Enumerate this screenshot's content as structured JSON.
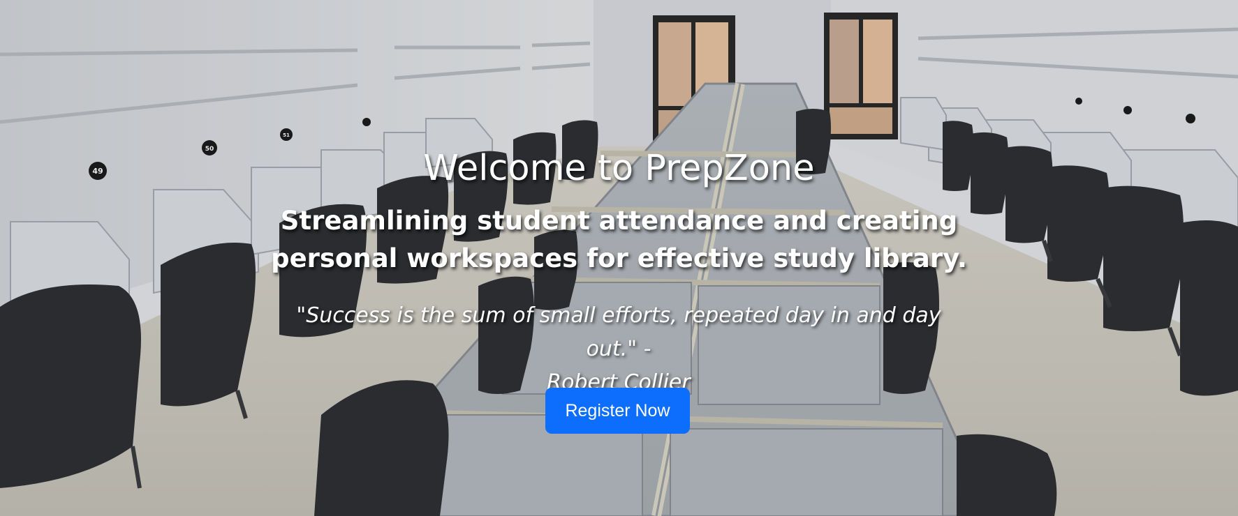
{
  "hero": {
    "title": "Welcome to PrepZone",
    "subtitle_line1": "Streamlining student attendance and creating",
    "subtitle_line2": "personal workspaces for effective study library.",
    "quote_line1": "\"Success is the sum of small efforts, repeated day in and day out.\" -",
    "quote_line2": "Robert Collier",
    "register_label": "Register Now",
    "seat_numbers": [
      "49",
      "50",
      "51"
    ]
  },
  "colors": {
    "button": "#0d6efd",
    "text": "#ffffff"
  }
}
